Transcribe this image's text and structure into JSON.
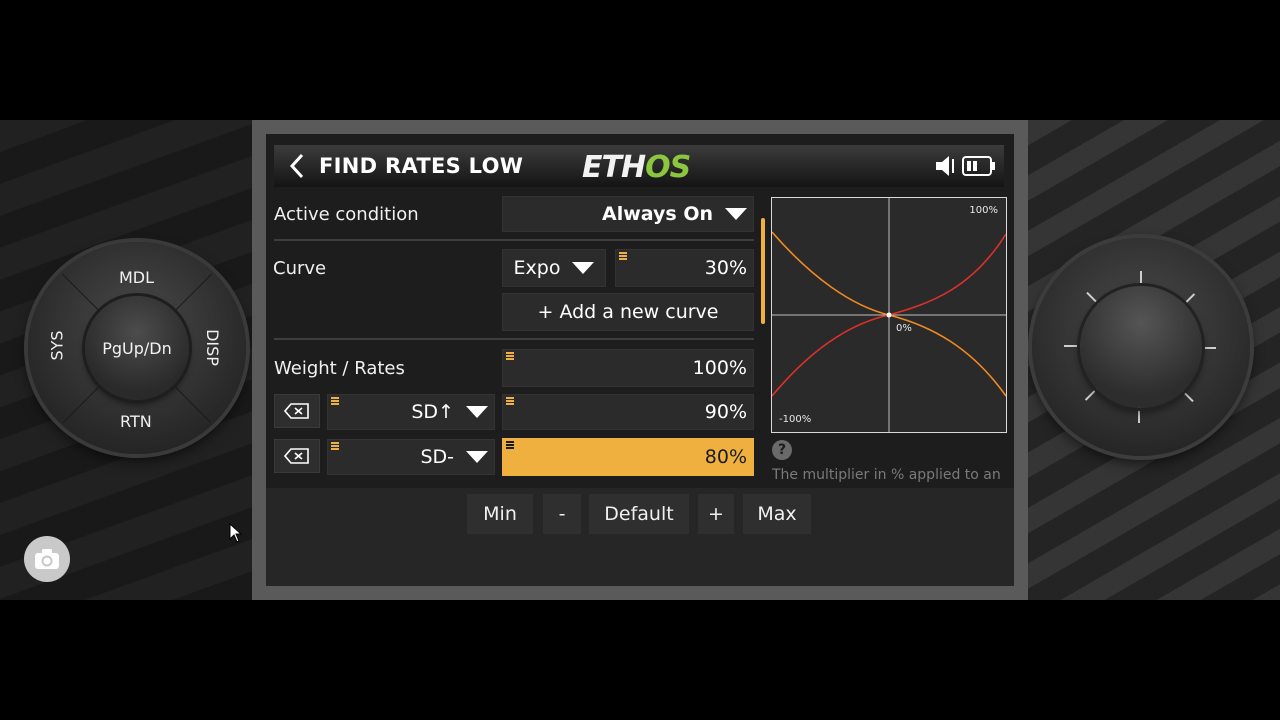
{
  "screen": {
    "title": "FIND RATES LOW",
    "logo": {
      "part1": "ETH",
      "part2": "OS"
    },
    "active_condition": {
      "label": "Active condition",
      "value": "Always On"
    },
    "curve": {
      "label": "Curve",
      "type": "Expo",
      "value": "30%",
      "add_button": "+ Add a new curve"
    },
    "weight_rates": {
      "label": "Weight / Rates",
      "base_value": "100%",
      "entries": [
        {
          "switch": "SD↑",
          "value": "90%"
        },
        {
          "switch": "SD-",
          "value": "80%",
          "selected": true
        }
      ]
    },
    "graph": {
      "top_label": "100%",
      "center_label": "0%",
      "bottom_label": "-100%"
    },
    "help_text": "The multiplier in % applied to an",
    "buttons": {
      "min": "Min",
      "minus": "-",
      "default": "Default",
      "plus": "+",
      "max": "Max"
    }
  },
  "nav_pad": {
    "top": "MDL",
    "bottom": "RTN",
    "left": "SYS",
    "right": "DISP",
    "center": "PgUp/Dn"
  },
  "colors": {
    "accent": "#f0b040",
    "logo_green": "#8cc63f",
    "curve_red": "#e0302a",
    "curve_orange": "#f08a20"
  }
}
